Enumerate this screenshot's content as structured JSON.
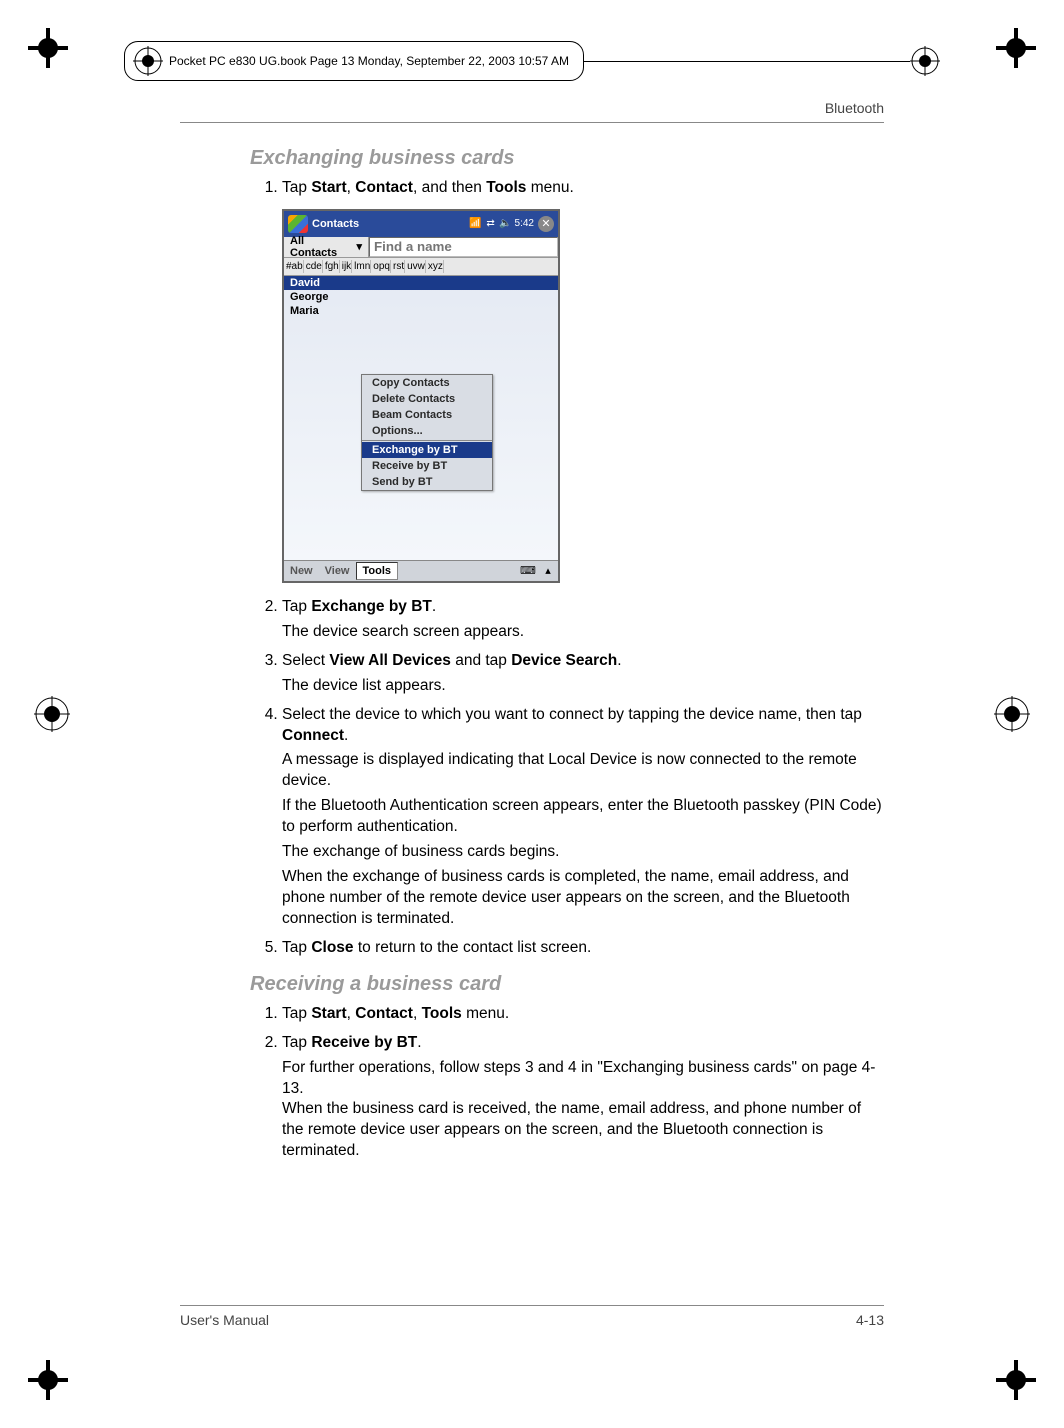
{
  "headerBar": "Pocket PC e830 UG.book  Page 13  Monday, September 22, 2003  10:57 AM",
  "runningHead": "Bluetooth",
  "section1": {
    "title": "Exchanging business cards",
    "step1": {
      "pre": "Tap ",
      "b1": "Start",
      "mid1": ", ",
      "b2": "Contact",
      "mid2": ", and then ",
      "b3": "Tools",
      "post": " menu."
    },
    "step2": {
      "pre": "Tap ",
      "b1": "Exchange by BT",
      "post": ".",
      "sub": "The device search screen appears."
    },
    "step3": {
      "pre": "Select ",
      "b1": "View All Devices",
      "mid": " and tap ",
      "b2": "Device Search",
      "post": ".",
      "sub": "The device list appears."
    },
    "step4": {
      "pre": "Select the device to which you want to connect by tapping the device name, then tap ",
      "b1": "Connect",
      "post": "."
    },
    "p4a": "A message is displayed indicating that Local Device is now connected to the remote device.",
    "p4b": "If the Bluetooth Authentication screen appears, enter the Bluetooth passkey (PIN Code) to perform authentication.",
    "p4c": "The exchange of business cards begins.",
    "p4d": "When the exchange of business cards is completed, the name, email address, and phone number of the remote device user appears on the screen, and the Bluetooth connection is terminated.",
    "step5": {
      "pre": "Tap ",
      "b1": "Close",
      "post": " to return to the contact list screen."
    }
  },
  "section2": {
    "title": "Receiving a business card",
    "step1": {
      "pre": "Tap ",
      "b1": "Start",
      "mid1": ", ",
      "b2": "Contact",
      "mid2": ", ",
      "b3": "Tools",
      "post": " menu."
    },
    "step2": {
      "pre": "Tap ",
      "b1": "Receive by BT",
      "post": ".",
      "sub": "For further operations, follow steps 3 and 4 in \"Exchanging business cards\" on page 4-13.\nWhen the business card is received, the name, email address, and phone number of the remote device user appears on the screen, and the Bluetooth connection is terminated."
    }
  },
  "footer": {
    "left": "User's Manual",
    "right": "4-13"
  },
  "screenshot": {
    "title": "Contacts",
    "time": "5:42",
    "allContacts": "All Contacts",
    "findPlaceholder": "Find a name",
    "alpha": [
      "#ab",
      "cde",
      "fgh",
      "ijk",
      "lmn",
      "opq",
      "rst",
      "uvw",
      "xyz"
    ],
    "rows": [
      "David",
      "George",
      "Maria"
    ],
    "menu": [
      "Copy Contacts",
      "Delete Contacts",
      "Beam Contacts",
      "Options...",
      "Exchange by BT",
      "Receive by BT",
      "Send by BT"
    ],
    "menuSelectedIndex": 4,
    "bottom": {
      "new": "New",
      "view": "View",
      "tools": "Tools"
    }
  }
}
